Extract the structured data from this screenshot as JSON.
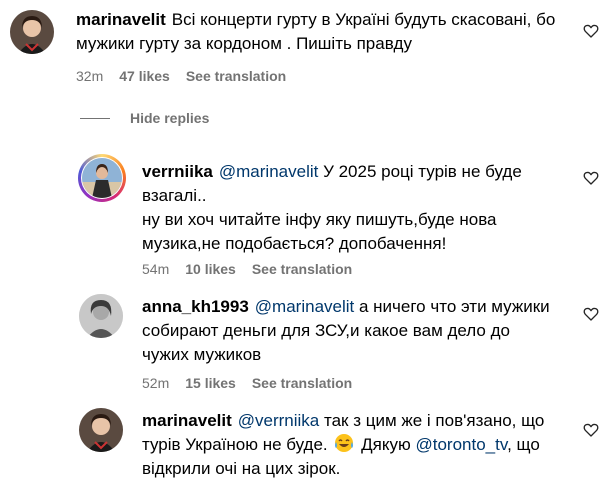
{
  "comments": [
    {
      "username": "marinavelit",
      "text": "Всі концерти гурту в Україні будуть скасовані, бо мужики гурту за кордоном . Пишіть правду",
      "time": "32m",
      "likes": "47 likes",
      "see_translation": "See translation"
    }
  ],
  "hide_replies": "Hide replies",
  "replies": [
    {
      "username": "verrniika",
      "mention": "@marinavelit",
      "text_line1": "У 2025 році турів не буде",
      "text_line2": "взагалі..",
      "text_line3": "ну ви хоч читайте інфу яку пишуть,буде нова",
      "text_line4": "музика,не подобається? допобачення!",
      "time": "54m",
      "likes": "10 likes",
      "see_translation": "See translation"
    },
    {
      "username": "anna_kh1993",
      "mention": "@marinavelit",
      "text_line1": "а ничего что эти мужики",
      "text_line2": "собирают деньги для ЗСУ,и какое вам дело до",
      "text_line3": "чужих мужиков",
      "time": "52m",
      "likes": "15 likes",
      "see_translation": "See translation"
    },
    {
      "username": "marinavelit",
      "mention": "@verrniika",
      "text_line1": "так з цим же і пов'язано, що",
      "text_line2a": "турів Україною не буде.",
      "emoji": "tears-of-joy-emoji",
      "text_line2b": "Дякую",
      "mention2": "@toronto_tv",
      "text_line2c": ", що",
      "text_line3": "відкрили очі на цих зірок."
    }
  ],
  "colors": {
    "mention": "#00376b",
    "meta": "#737373"
  }
}
